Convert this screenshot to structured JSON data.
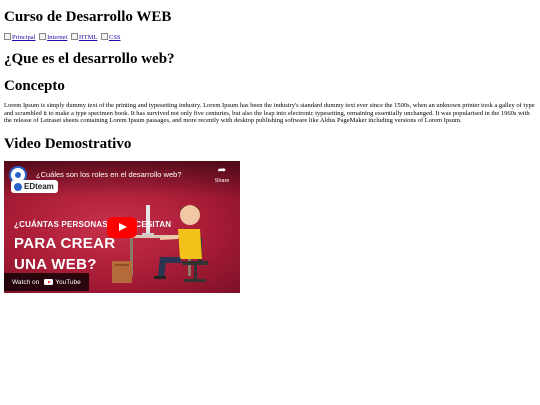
{
  "page": {
    "title": "Curso de Desarrollo WEB"
  },
  "nav": {
    "links": [
      {
        "label": "Principal"
      },
      {
        "label": "Internet"
      },
      {
        "label": "HTML"
      },
      {
        "label": "CSS"
      }
    ]
  },
  "sections": {
    "question_heading": "¿Que es el desarrollo web?",
    "concept_heading": "Concepto",
    "concept_text": "Lorem Ipsum is simply dummy text of the printing and typesetting industry. Lorem Ipsum has been the industry's standard dummy text ever since the 1500s, when an unknown printer took a galley of type and scrambled it to make a type specimen book. It has survived not only five centuries, but also the leap into electronic typesetting, remaining essentially unchanged. It was popularised in the 1960s with the release of Letraset sheets containing Lorem Ipsum passages, and more recently with desktop publishing software like Aldus PageMaker including versions of Lorem Ipsum.",
    "video_heading": "Video Demostrativo"
  },
  "video": {
    "title": "¿Cuáles son los roles en el desarrollo web?",
    "share_label": "Share",
    "brand": "EDteam",
    "overlay_kicker": "¿CUÁNTAS PERSONAS SE NECESITAN",
    "overlay_line1": "PARA CREAR",
    "overlay_line2": "UNA WEB?",
    "watch_on_label": "Watch on",
    "platform_label": "YouTube",
    "colors": {
      "background": "#b0203a",
      "play_button": "#ff0000",
      "brand_blue": "#2a62c9"
    },
    "icons": [
      "share-icon",
      "play-icon",
      "youtube-icon",
      "channel-logo-icon"
    ]
  }
}
